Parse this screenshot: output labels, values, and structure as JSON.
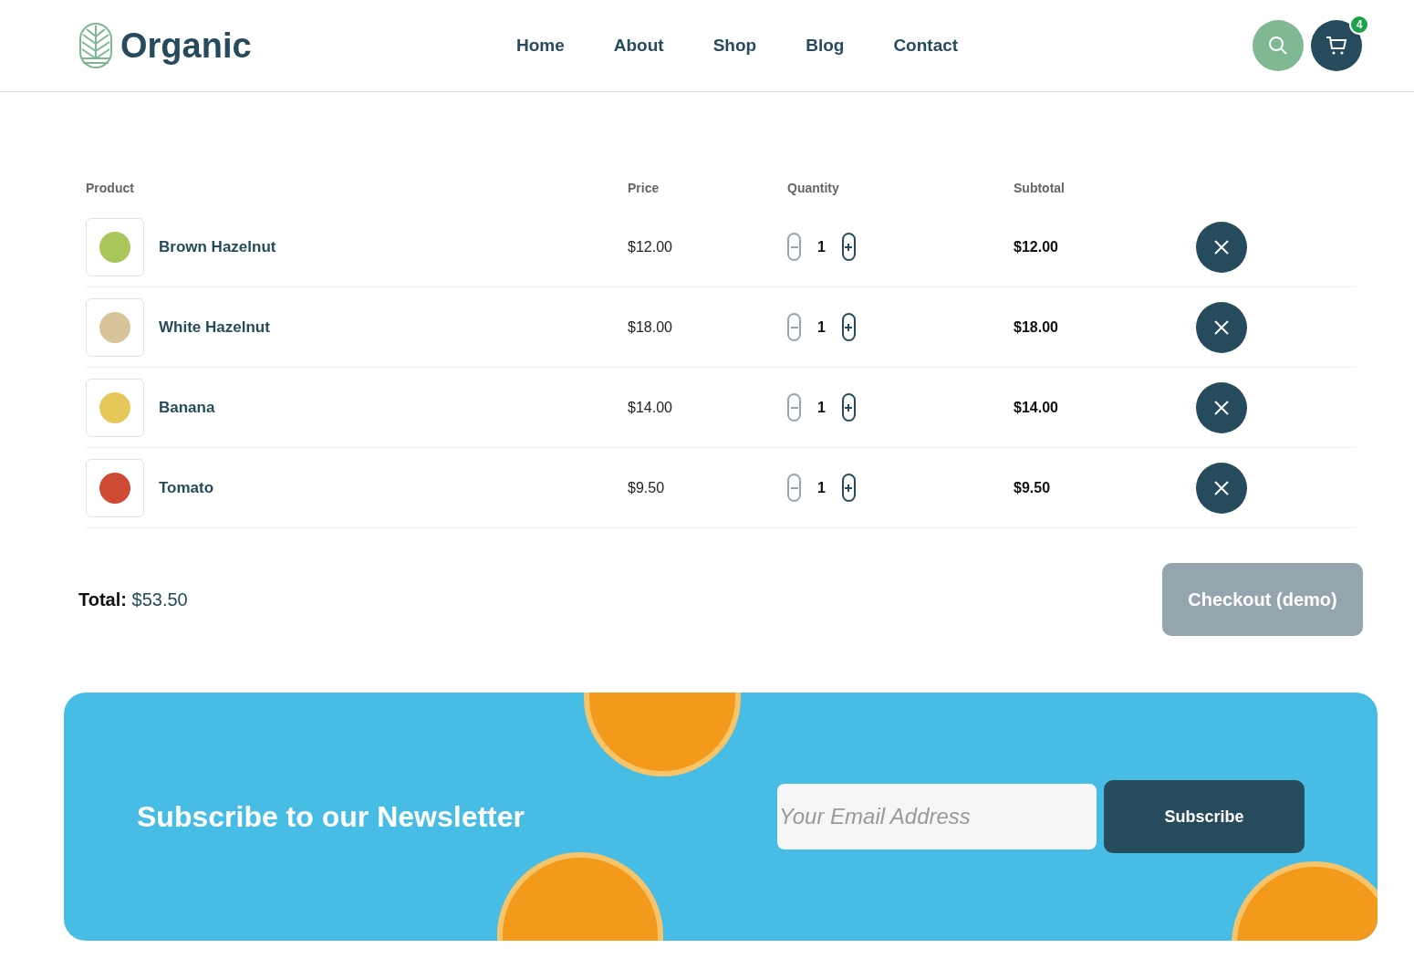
{
  "header": {
    "logo": "Organic",
    "nav": [
      {
        "label": "Home"
      },
      {
        "label": "About"
      },
      {
        "label": "Shop"
      },
      {
        "label": "Blog"
      },
      {
        "label": "Contact"
      }
    ],
    "cart_count": "4"
  },
  "cart": {
    "columns": [
      "Product",
      "Price",
      "Quantity",
      "Subtotal"
    ],
    "rows": [
      {
        "name": "Brown Hazelnut",
        "price": "$12.00",
        "quantity": "1",
        "decrease_disabled": true,
        "subtotal": "$12.00"
      },
      {
        "name": "White Hazelnut",
        "price": "$18.00",
        "quantity": "1",
        "decrease_disabled": true,
        "subtotal": "$18.00"
      },
      {
        "name": "Banana",
        "price": "$14.00",
        "quantity": "1",
        "decrease_disabled": true,
        "subtotal": "$14.00"
      },
      {
        "name": "Tomato",
        "price": "$9.50",
        "quantity": "1",
        "decrease_disabled": true,
        "subtotal": "$9.50"
      }
    ],
    "total": "**Total:** $53.50",
    "checkout": {
      "label": "Checkout (demo)",
      "disabled": true
    }
  },
  "newsletter": {
    "title": "Subscribe to our Newsletter",
    "email": {
      "placeholder": "Your Email Address"
    },
    "button": "Subscribe"
  }
}
